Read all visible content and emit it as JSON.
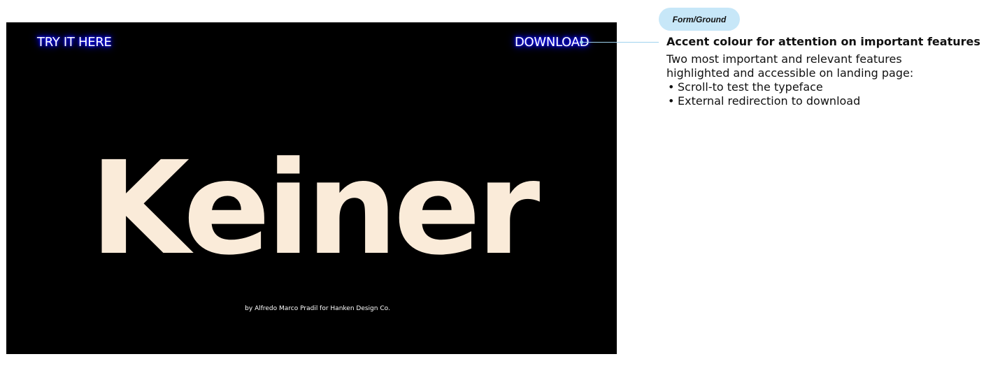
{
  "site_preview": {
    "nav": {
      "try_label": "TRY IT HERE",
      "download_label": "DOWNLOAD"
    },
    "hero_title": "Keiner",
    "credit": "by Alfredo Marco Pradil for Hanken Design Co.",
    "colors": {
      "background": "#000000",
      "title": "#faebd9",
      "accent_glow": "#0000ff",
      "link_text": "#ffffff"
    }
  },
  "annotation": {
    "tag": "Form/Ground",
    "heading": "Accent colour for attention on important features",
    "body_line_1": "Two most important and relevant features",
    "body_line_2": "highlighted and accessible on landing page:",
    "bullets": [
      "Scroll-to test the typeface",
      "External redirection to download"
    ],
    "bullet_symbol": "•",
    "colors": {
      "tag_bg": "#c7e7f8",
      "connector": "#9fd2ee"
    }
  }
}
